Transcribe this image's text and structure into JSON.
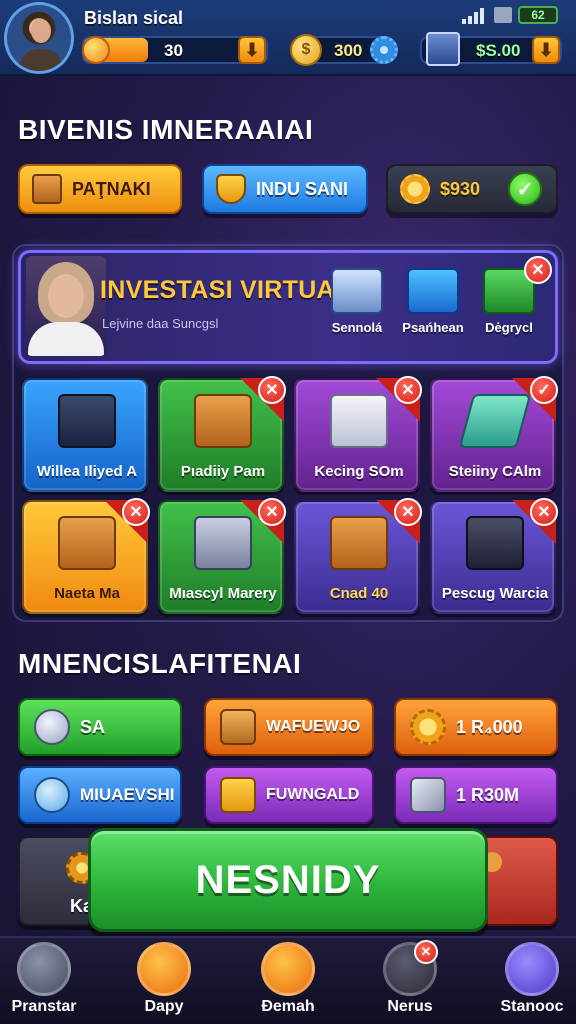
{
  "header": {
    "username": "Bislan sical",
    "xp_value": "30",
    "xp_progress": 0.35,
    "coins": "300",
    "cash": "$S.00",
    "battery": "62"
  },
  "section1": {
    "title": "BIVENIS IMNERAAIAI"
  },
  "top_buttons": [
    {
      "label": "PAŢNAKI",
      "icon": "crate-icon"
    },
    {
      "label": "INDU SANI",
      "icon": "shield-icon"
    },
    {
      "label": "$930",
      "icon": "coin-burst-icon"
    }
  ],
  "banner": {
    "title": "INVESTASI VIRTUAL",
    "subtitle": "Lejvine daa Suncgsl",
    "items": [
      {
        "label": "Sennolá",
        "icon": "laptop-icon"
      },
      {
        "label": "Psańhean",
        "icon": "server-icon"
      },
      {
        "label": "Dėgrycl",
        "icon": "cash-register-icon"
      }
    ]
  },
  "tiles": [
    {
      "label": "Willea Iliyed A",
      "icon": "chart-monitor-icon",
      "color": "blue",
      "badge": "none"
    },
    {
      "label": "Pıadiiy Pam",
      "icon": "crate-icon",
      "color": "green",
      "badge": "close"
    },
    {
      "label": "Kecing SOm",
      "icon": "document-coins-icon",
      "color": "purple",
      "badge": "close"
    },
    {
      "label": "Steiiny CAlm",
      "icon": "map-icon",
      "color": "purple",
      "badge": "check"
    },
    {
      "label": "Naeta Ma",
      "icon": "crate-coin-icon",
      "color": "orange",
      "badge": "close"
    },
    {
      "label": "Mıascyl Marery",
      "icon": "machine-icon",
      "color": "green",
      "badge": "close"
    },
    {
      "label": "Cnad 40",
      "icon": "crate-lock-icon",
      "color": "indigo",
      "badge": "close"
    },
    {
      "label": "Pescug Warcia",
      "icon": "server-rack-icon",
      "color": "indigo",
      "badge": "close"
    }
  ],
  "section2": {
    "title": "MNENCISLAFITENAI"
  },
  "lower_buttons": [
    {
      "label": "SA",
      "icon": "medal-icon",
      "color": "green"
    },
    {
      "label": "WAFUEWJO",
      "icon": "briefcase-icon",
      "color": "orange"
    },
    {
      "label": "1 R₄000",
      "icon": "gear-coin-icon",
      "color": "orange"
    },
    {
      "label": "MIUAEVSHI",
      "icon": "globe-icon",
      "color": "blue"
    },
    {
      "label": "FUWNGALD",
      "icon": "cash-stack-icon",
      "color": "purple"
    },
    {
      "label": "1 R30M",
      "icon": "wrench-icon",
      "color": "purple"
    },
    {
      "label": "Ka",
      "icon": "gear-icon",
      "color": "grey"
    }
  ],
  "cta": {
    "label": "NESNIDY"
  },
  "nav": [
    {
      "label": "Pranstar",
      "icon": "home-icon"
    },
    {
      "label": "Dapy",
      "icon": "pin-icon"
    },
    {
      "label": "Ɖemah",
      "icon": "shield-icon"
    },
    {
      "label": "Nerus",
      "icon": "edit-icon"
    },
    {
      "label": "Stanooc",
      "icon": "store-icon"
    }
  ]
}
